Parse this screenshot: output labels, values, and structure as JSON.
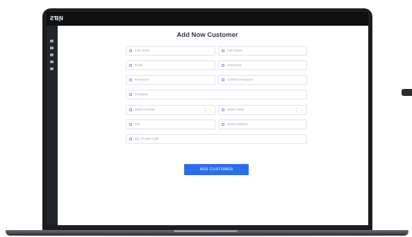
{
  "app": {
    "logo": "ƧƁƝ"
  },
  "form": {
    "title": "Add Now Customer",
    "fields": {
      "first_name": "First Name",
      "last_name": "Last Name",
      "email": "Email",
      "username": "Username",
      "password": "Password",
      "confirm_password": "Confirm Password",
      "company": "Company",
      "select_country": "Select Country",
      "select_state": "Select State",
      "city": "City",
      "street_address": "Street Address",
      "zip": "Zip / Postal Code"
    },
    "submit_label": "ADD CUSTOMER"
  },
  "colors": {
    "accent": "#2c6ee8",
    "sidebar": "#23252c",
    "topbar": "#0f1012"
  },
  "icons": {
    "sidebar": [
      "menu-icon",
      "home-icon",
      "users-icon",
      "chart-icon",
      "settings-icon"
    ]
  }
}
